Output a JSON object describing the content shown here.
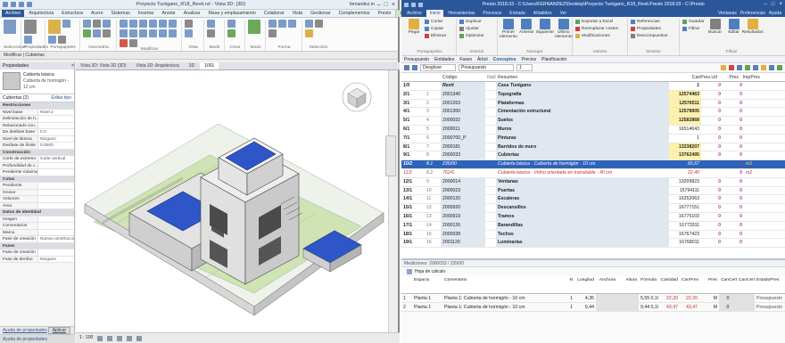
{
  "revit": {
    "title": "Proyecto Turégano_R18_Revit.rvt - Vista 3D: {3D}",
    "search_hint": "Escriba palabra clave o frase",
    "user": "fernandez.m",
    "tabs": [
      "Archivo",
      "Arquitectura",
      "Estructura",
      "Acero",
      "Sistemas",
      "Insertar",
      "Anotar",
      "Analizar",
      "Masa y emplazamiento",
      "Colaborar",
      "Vista",
      "Gestionar",
      "Complementos",
      "Presto",
      "Modificar | Cubiertas"
    ],
    "ribbon_groups": [
      "Seleccionar",
      "Propiedades",
      "Portapapeles",
      "Geometría",
      "Modificar",
      "Vista",
      "Medir",
      "Crear",
      "Modo",
      "Forma",
      "Selección"
    ],
    "ribbon_labels": {
      "modify": "Modificar",
      "paste": "Pegar",
      "cut": "Cortar",
      "join": "Unir",
      "unlink": "Desajustar",
      "edit_border": "Editar contorno"
    },
    "options_bar": "Modificar | Cubiertas",
    "properties": {
      "header": "Propiedades",
      "type_name": "Cubierta básica",
      "type_sub": "Cubierta de hormigón - 12 cm",
      "selection": "Cubiertas (2)",
      "edit_type": "Editar tipo",
      "rows": [
        {
          "section": "Restricciones"
        },
        {
          "k": "Nivel base",
          "v": "Nivel 2"
        },
        {
          "k": "Delimitación de h...",
          "v": ""
        },
        {
          "k": "Relacionado con...",
          "v": ""
        },
        {
          "k": "De desfase base",
          "v": "0.0"
        },
        {
          "k": "Nivel de lámina",
          "v": "Ninguno"
        },
        {
          "k": "Desfase de límite",
          "v": "0.0000"
        },
        {
          "section": "Construcción"
        },
        {
          "k": "Corte de extremo",
          "v": "Corte vertical"
        },
        {
          "k": "Profundidad de c...",
          "v": ""
        },
        {
          "k": "Pendiente máxima",
          "v": ""
        },
        {
          "section": "Cotas"
        },
        {
          "k": "Pendiente",
          "v": ""
        },
        {
          "k": "Grosor",
          "v": ""
        },
        {
          "k": "Volumen",
          "v": ""
        },
        {
          "k": "Área",
          "v": ""
        },
        {
          "section": "Datos de identidad"
        },
        {
          "k": "Imagen",
          "v": ""
        },
        {
          "k": "Comentarios",
          "v": ""
        },
        {
          "k": "Marca",
          "v": ""
        },
        {
          "k": "Fase de creación",
          "v": "Nueva construcción"
        },
        {
          "section": "Fases"
        },
        {
          "k": "Fase de creación",
          "v": ""
        },
        {
          "k": "Fase de derribo",
          "v": "Ninguno"
        }
      ],
      "footer_link": "Ayuda de propiedades",
      "apply": "Aplicar"
    },
    "view_tabs": [
      "Vista 3D: Vista 3D {3D}",
      "Vista 3D: Arquitectura",
      "3D",
      "1001"
    ],
    "view_control": "1 : 100",
    "status": "Ayuda de propiedades"
  },
  "presto": {
    "title": "Presto 2018.03 - C:\\Users\\FERNANDEZ\\Desktop\\Proyecto Turégano_R18_Revit.Presto 2018.03 - C:\\Presto",
    "tabs": [
      "Archivo",
      "Inicio",
      "Herramientas",
      "Procesos",
      "Entrada",
      "Añadidos",
      "Ver"
    ],
    "tabs_right": [
      "Ventanas",
      "Preferencias",
      "Ayuda"
    ],
    "ribbon": {
      "clipboard": {
        "label": "Portapapeles",
        "paste": "Pegar",
        "cut": "Cortar",
        "copy": "Copiar",
        "delete": "Eliminar"
      },
      "insert": {
        "label": "Insertar",
        "items": [
          "Duplicar",
          "Ajustar",
          "Optimizar"
        ]
      },
      "navigate": {
        "label": "Navegar",
        "first": "Primer elemento",
        "prev": "Anterior",
        "next": "Siguiente",
        "last": "Último elemento"
      },
      "values": {
        "label": "Valores",
        "items": [
          "Exportar a Excel",
          "Reemplazar costes",
          "Modificaciones"
        ]
      },
      "show": {
        "label": "Mostrar",
        "items": [
          "Referencias",
          "Propiedades",
          "Descompuestos"
        ]
      },
      "filter": {
        "label": "Filtrar",
        "save": "Guardar",
        "filter_btn": "Filtrar",
        "search": "Buscar",
        "edit": "Editar",
        "results": "Resultados"
      }
    },
    "view_bar": [
      "Presupuesto",
      "Entidades",
      "Fases",
      "Árbol",
      "Conceptos",
      "Precios",
      "Planificación"
    ],
    "toolbar": {
      "combo1": "Desglose",
      "combo2": "Presupuesto",
      "combo3": "1"
    },
    "columns": {
      "num": "",
      "nat": "",
      "code": "Código",
      "nc": "NatC",
      "summary": "Resumen",
      "ud": "",
      "qty": "CanPres.Ud",
      "price": "Pres",
      "amount": "ImpPres"
    },
    "rows": [
      {
        "kind": "root",
        "num": "1/0",
        "nat": "",
        "code": "Revit",
        "nc": "",
        "summary": "Casa Turégano",
        "ud": "",
        "qty": "1",
        "qhl": false,
        "price": "0",
        "amount": "0"
      },
      {
        "kind": "chap",
        "num": "2/1",
        "nat": "1",
        "code": "2001340",
        "nc": "",
        "summary": "Topografía",
        "ud": "",
        "qty": "12574463",
        "qhl": true,
        "price": "0",
        "amount": "0"
      },
      {
        "kind": "chap",
        "num": "3/1",
        "nat": "2",
        "code": "2001263",
        "nc": "",
        "summary": "Plataformas",
        "ud": "",
        "qty": "12576511",
        "qhl": true,
        "price": "0",
        "amount": "0"
      },
      {
        "kind": "chap",
        "num": "4/1",
        "nat": "3",
        "code": "2001300",
        "nc": "",
        "summary": "Cimentación estructural",
        "ud": "",
        "qty": "12578905",
        "qhl": true,
        "price": "0",
        "amount": "0"
      },
      {
        "kind": "chap",
        "num": "5/1",
        "nat": "4",
        "code": "2000032",
        "nc": "",
        "summary": "Suelos",
        "ud": "",
        "qty": "12582868",
        "qhl": true,
        "price": "0",
        "amount": "0"
      },
      {
        "kind": "chap",
        "num": "6/1",
        "nat": "5",
        "code": "2000011",
        "nc": "",
        "summary": "Muros",
        "ud": "",
        "qty": "16514043",
        "qhl": false,
        "price": "0",
        "amount": "0"
      },
      {
        "kind": "chap",
        "num": "7/1",
        "nat": "6",
        "code": "2000700_P",
        "nc": "",
        "summary": "Pinturas",
        "ud": "",
        "qty": "1",
        "qhl": false,
        "price": "0",
        "amount": "0"
      },
      {
        "kind": "chap",
        "num": "8/1",
        "nat": "7",
        "code": "2000181",
        "nc": "",
        "summary": "Barridos de muro",
        "ud": "",
        "qty": "13238207",
        "qhl": true,
        "price": "0",
        "amount": "0"
      },
      {
        "kind": "chap",
        "num": "9/1",
        "nat": "8",
        "code": "2000033",
        "nc": "",
        "summary": "Cubiertas",
        "ud": "",
        "qty": "13762495",
        "qhl": true,
        "price": "0",
        "amount": "0"
      },
      {
        "kind": "hl",
        "num": "10/2",
        "nat": "8.1",
        "code": "235/00",
        "nc": "",
        "summary": "Cubierta básica · Cubierta de hormigón · 10 cm",
        "ud": "",
        "qty": "65,67",
        "unit": "m2",
        "qhl": false,
        "price": "",
        "amount": "0"
      },
      {
        "kind": "sub",
        "num": "11/2",
        "nat": "8.2",
        "code": "762/6",
        "nc": "",
        "summary": "Cubierta básica · Vidrio orientado en transitable · 40 cm",
        "ud": "",
        "qty": "22,40",
        "unit": "m2",
        "qhl": false,
        "price": "",
        "amount": "0"
      },
      {
        "kind": "chap",
        "num": "12/1",
        "nat": "9",
        "code": "2000014",
        "nc": "",
        "summary": "Ventanas",
        "ud": "",
        "qty": "13209823",
        "qhl": false,
        "price": "0",
        "amount": "0"
      },
      {
        "kind": "chap",
        "num": "13/1",
        "nat": "10",
        "code": "2000023",
        "nc": "",
        "summary": "Puertas",
        "ud": "",
        "qty": "15794111",
        "qhl": false,
        "price": "0",
        "amount": "0"
      },
      {
        "kind": "chap",
        "num": "14/1",
        "nat": "11",
        "code": "2000120",
        "nc": "",
        "summary": "Escaleras",
        "ud": "",
        "qty": "16252063",
        "qhl": false,
        "price": "0",
        "amount": "0"
      },
      {
        "kind": "chap",
        "num": "15/1",
        "nat": "12",
        "code": "2000920",
        "nc": "",
        "summary": "Descansillos",
        "ud": "",
        "qty": "16777151",
        "qhl": false,
        "price": "0",
        "amount": "0"
      },
      {
        "kind": "chap",
        "num": "16/1",
        "nat": "13",
        "code": "2000919",
        "nc": "",
        "summary": "Tramos",
        "ud": "",
        "qty": "16775103",
        "qhl": false,
        "price": "0",
        "amount": "0"
      },
      {
        "kind": "chap",
        "num": "17/1",
        "nat": "14",
        "code": "2000126",
        "nc": "",
        "summary": "Barandillas",
        "ud": "",
        "qty": "16773311",
        "qhl": false,
        "price": "0",
        "amount": "0"
      },
      {
        "kind": "chap",
        "num": "18/1",
        "nat": "15",
        "code": "2000038",
        "nc": "",
        "summary": "Techos",
        "ud": "",
        "qty": "16767423",
        "qhl": false,
        "price": "0",
        "amount": "0"
      },
      {
        "kind": "chap",
        "num": "19/1",
        "nat": "16",
        "code": "2001120",
        "nc": "",
        "summary": "Luminarias",
        "ud": "",
        "qty": "16768011",
        "qhl": false,
        "price": "0",
        "amount": "0"
      }
    ],
    "lower": {
      "header": "Mediciones: 2000033 / 235/00",
      "tab": "Hoja de cálculo",
      "columns": [
        "",
        "Espacio",
        "Comentario",
        "N",
        "Longitud",
        "Anchura",
        "Altura",
        "Fórmula",
        "Cantidad",
        "CanPres",
        "Pres",
        "CanCert",
        "CanCert",
        "EstadoPres"
      ],
      "total_qty": "65,67",
      "rows": [
        {
          "idx": "1",
          "space": "Planta 1",
          "comment": "Planta 1: Cubierta de hormigón - 10 cm",
          "n": "1",
          "len": "4,35",
          "wid": "",
          "hei": "",
          "form": "5,55  0,10",
          "qty": "22,20",
          "canpres": "22,20",
          "pres": "M",
          "cert": "0",
          "status": "Presupuesto"
        },
        {
          "idx": "2",
          "space": "Planta 1",
          "comment": "Planta 1: Cubierta de hormigón - 10 cm",
          "n": "1",
          "len": "9,44",
          "wid": "",
          "hei": "",
          "form": "9,44  0,10",
          "qty": "43,47",
          "canpres": "43,47",
          "pres": "M",
          "cert": "0",
          "status": "Presupuesto"
        }
      ]
    }
  }
}
